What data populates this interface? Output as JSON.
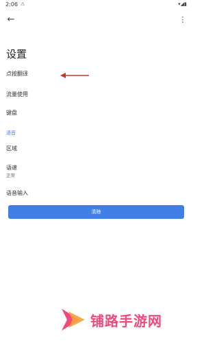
{
  "status_bar": {
    "time": "2:06"
  },
  "app_bar": {
    "back_icon": "back-arrow-icon",
    "more_icon": "more-vert-icon"
  },
  "page": {
    "title": "设置"
  },
  "items": [
    {
      "label": "点按翻译"
    },
    {
      "label": "流量使用"
    },
    {
      "label": "键盘"
    }
  ],
  "section": {
    "title": "语音"
  },
  "voice_items": [
    {
      "label": "区域"
    },
    {
      "label": "语速",
      "sub": "正常"
    },
    {
      "label": "语音输入"
    }
  ],
  "button": {
    "label": "清除"
  },
  "watermark": {
    "text": "铺路手游网"
  },
  "colors": {
    "accent": "#3f7fe6",
    "annotation": "#c0392b",
    "watermark": "#f04a7a"
  }
}
